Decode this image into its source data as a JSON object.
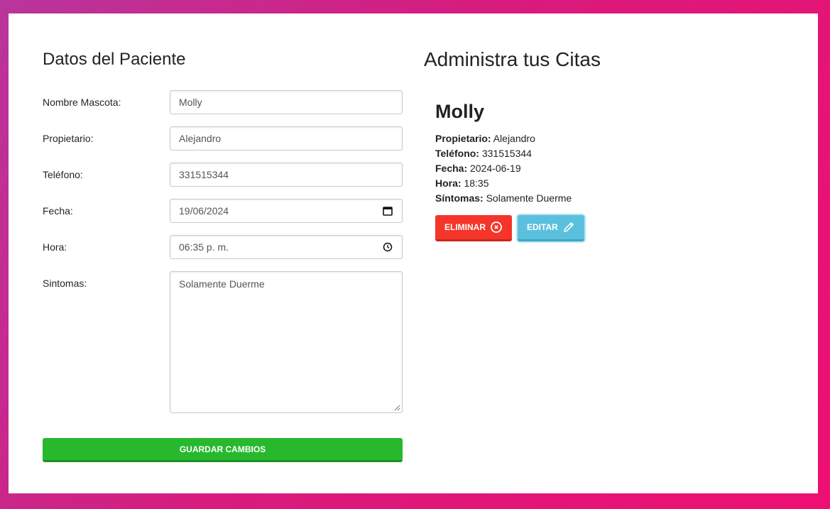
{
  "form": {
    "title": "Datos del Paciente",
    "fields": [
      {
        "label": "Nombre Mascota:",
        "value": "Molly"
      },
      {
        "label": "Propietario:",
        "value": "Alejandro"
      },
      {
        "label": "Teléfono:",
        "value": "331515344"
      },
      {
        "label": "Fecha:",
        "value": "19/06/2024"
      },
      {
        "label": "Hora:",
        "value": "06:35 p. m."
      },
      {
        "label": "Sintomas:",
        "value": "Solamente Duerme"
      }
    ],
    "save_label": "GUARDAR CAMBIOS"
  },
  "list": {
    "title": "Administra tus Citas",
    "appointment": {
      "name": "Molly",
      "owner_label": "Propietario:",
      "owner": "Alejandro",
      "phone_label": "Teléfono:",
      "phone": "331515344",
      "date_label": "Fecha:",
      "date": "2024-06-19",
      "time_label": "Hora:",
      "time": "18:35",
      "symptoms_label": "Síntomas:",
      "symptoms": "Solamente Duerme"
    },
    "delete_label": "ELIMINAR",
    "edit_label": "EDITAR"
  },
  "colors": {
    "save": "#28b82e",
    "delete": "#f5352a",
    "edit": "#5bc0de"
  },
  "icons": {
    "delete": "x-circle-icon",
    "edit": "pencil-icon",
    "date": "calendar-icon",
    "time": "clock-icon"
  }
}
